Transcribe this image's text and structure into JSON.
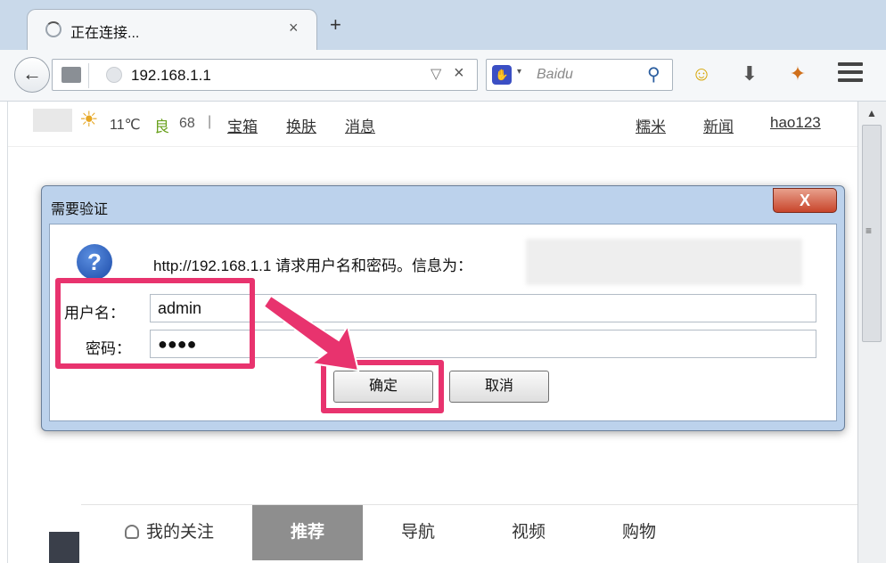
{
  "browser": {
    "tab_title": "正在连接...",
    "tab_close": "×",
    "new_tab": "+",
    "url": "192.168.1.1",
    "url_dropdown": "▽",
    "url_clear": "×",
    "search_engine_placeholder": "Baidu",
    "search_engine_caret": "▾"
  },
  "page": {
    "weather": {
      "temp": "11℃",
      "aqi_label": "良",
      "aqi_value": "68",
      "divider": "|"
    },
    "left_links": [
      "宝箱",
      "换肤",
      "消息"
    ],
    "right_links": [
      "糯米",
      "新闻",
      "hao123"
    ],
    "content_tabs": [
      {
        "label": "我的关注",
        "active": false
      },
      {
        "label": "推荐",
        "active": true
      },
      {
        "label": "导航",
        "active": false
      },
      {
        "label": "视频",
        "active": false
      },
      {
        "label": "购物",
        "active": false
      }
    ]
  },
  "dialog": {
    "title": "需要验证",
    "close_glyph": "X",
    "message": "http://192.168.1.1 请求用户名和密码。信息为：",
    "username_label": "用户名：",
    "username_value": "admin",
    "password_label": "密码：",
    "password_value": "●●●●",
    "ok_label": "确定",
    "cancel_label": "取消"
  },
  "colors": {
    "highlight": "#e8336e",
    "dialog_frame": "#bcd2ec",
    "tab_active": "#8e8e8e"
  },
  "icons": [
    "back-arrow-icon",
    "folder-icon",
    "globe-icon",
    "search-icon",
    "baidu-paw-icon",
    "sync-icon",
    "download-icon",
    "extension-icon",
    "hamburger-menu-icon",
    "sun-cloud-icon",
    "question-icon",
    "user-icon"
  ]
}
